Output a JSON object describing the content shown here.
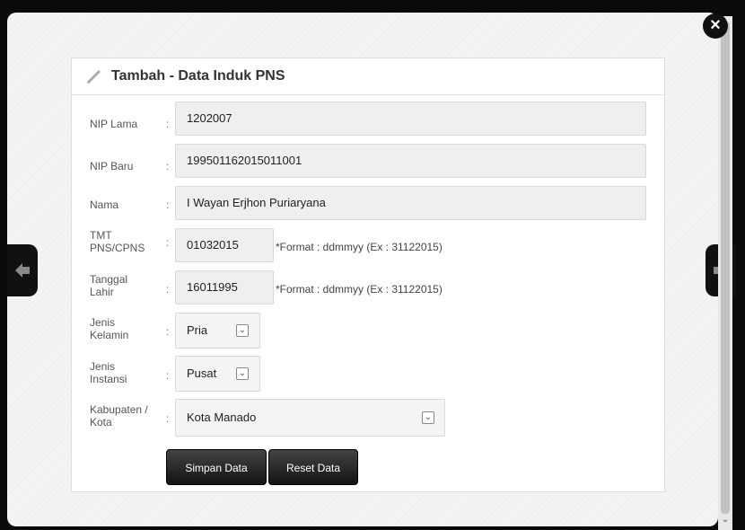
{
  "modal": {
    "close_label": "×",
    "prev_icon": "arrow-left-icon",
    "next_icon": "arrow-right-icon"
  },
  "form": {
    "title": "Tambah - Data Induk PNS",
    "title_icon": "pencil-icon",
    "fields": {
      "nip_lama": {
        "label": "NIP Lama",
        "value": "1202007"
      },
      "nip_baru": {
        "label": "NIP Baru",
        "value": "199501162015011001"
      },
      "nama": {
        "label": "Nama",
        "value": "I Wayan Erjhon Puriaryana"
      },
      "tmt": {
        "label_1": "TMT",
        "label_2": "PNS/CPNS",
        "value": "01032015",
        "hint": "*Format : ddmmyy (Ex : 31122015)"
      },
      "tanggal_lahir": {
        "label_1": "Tanggal",
        "label_2": "Lahir",
        "value": "16011995",
        "hint": "*Format : ddmmyy (Ex : 31122015)"
      },
      "jenis_kelamin": {
        "label_1": "Jenis",
        "label_2": "Kelamin",
        "value": "Pria"
      },
      "jenis_instansi": {
        "label_1": "Jenis",
        "label_2": "Instansi",
        "value": "Pusat"
      },
      "kabupaten_kota": {
        "label_1": "Kabupaten /",
        "label_2": "Kota",
        "value": "Kota Manado"
      }
    },
    "separator": ":",
    "buttons": {
      "save": "Simpan Data",
      "reset": "Reset Data"
    }
  }
}
